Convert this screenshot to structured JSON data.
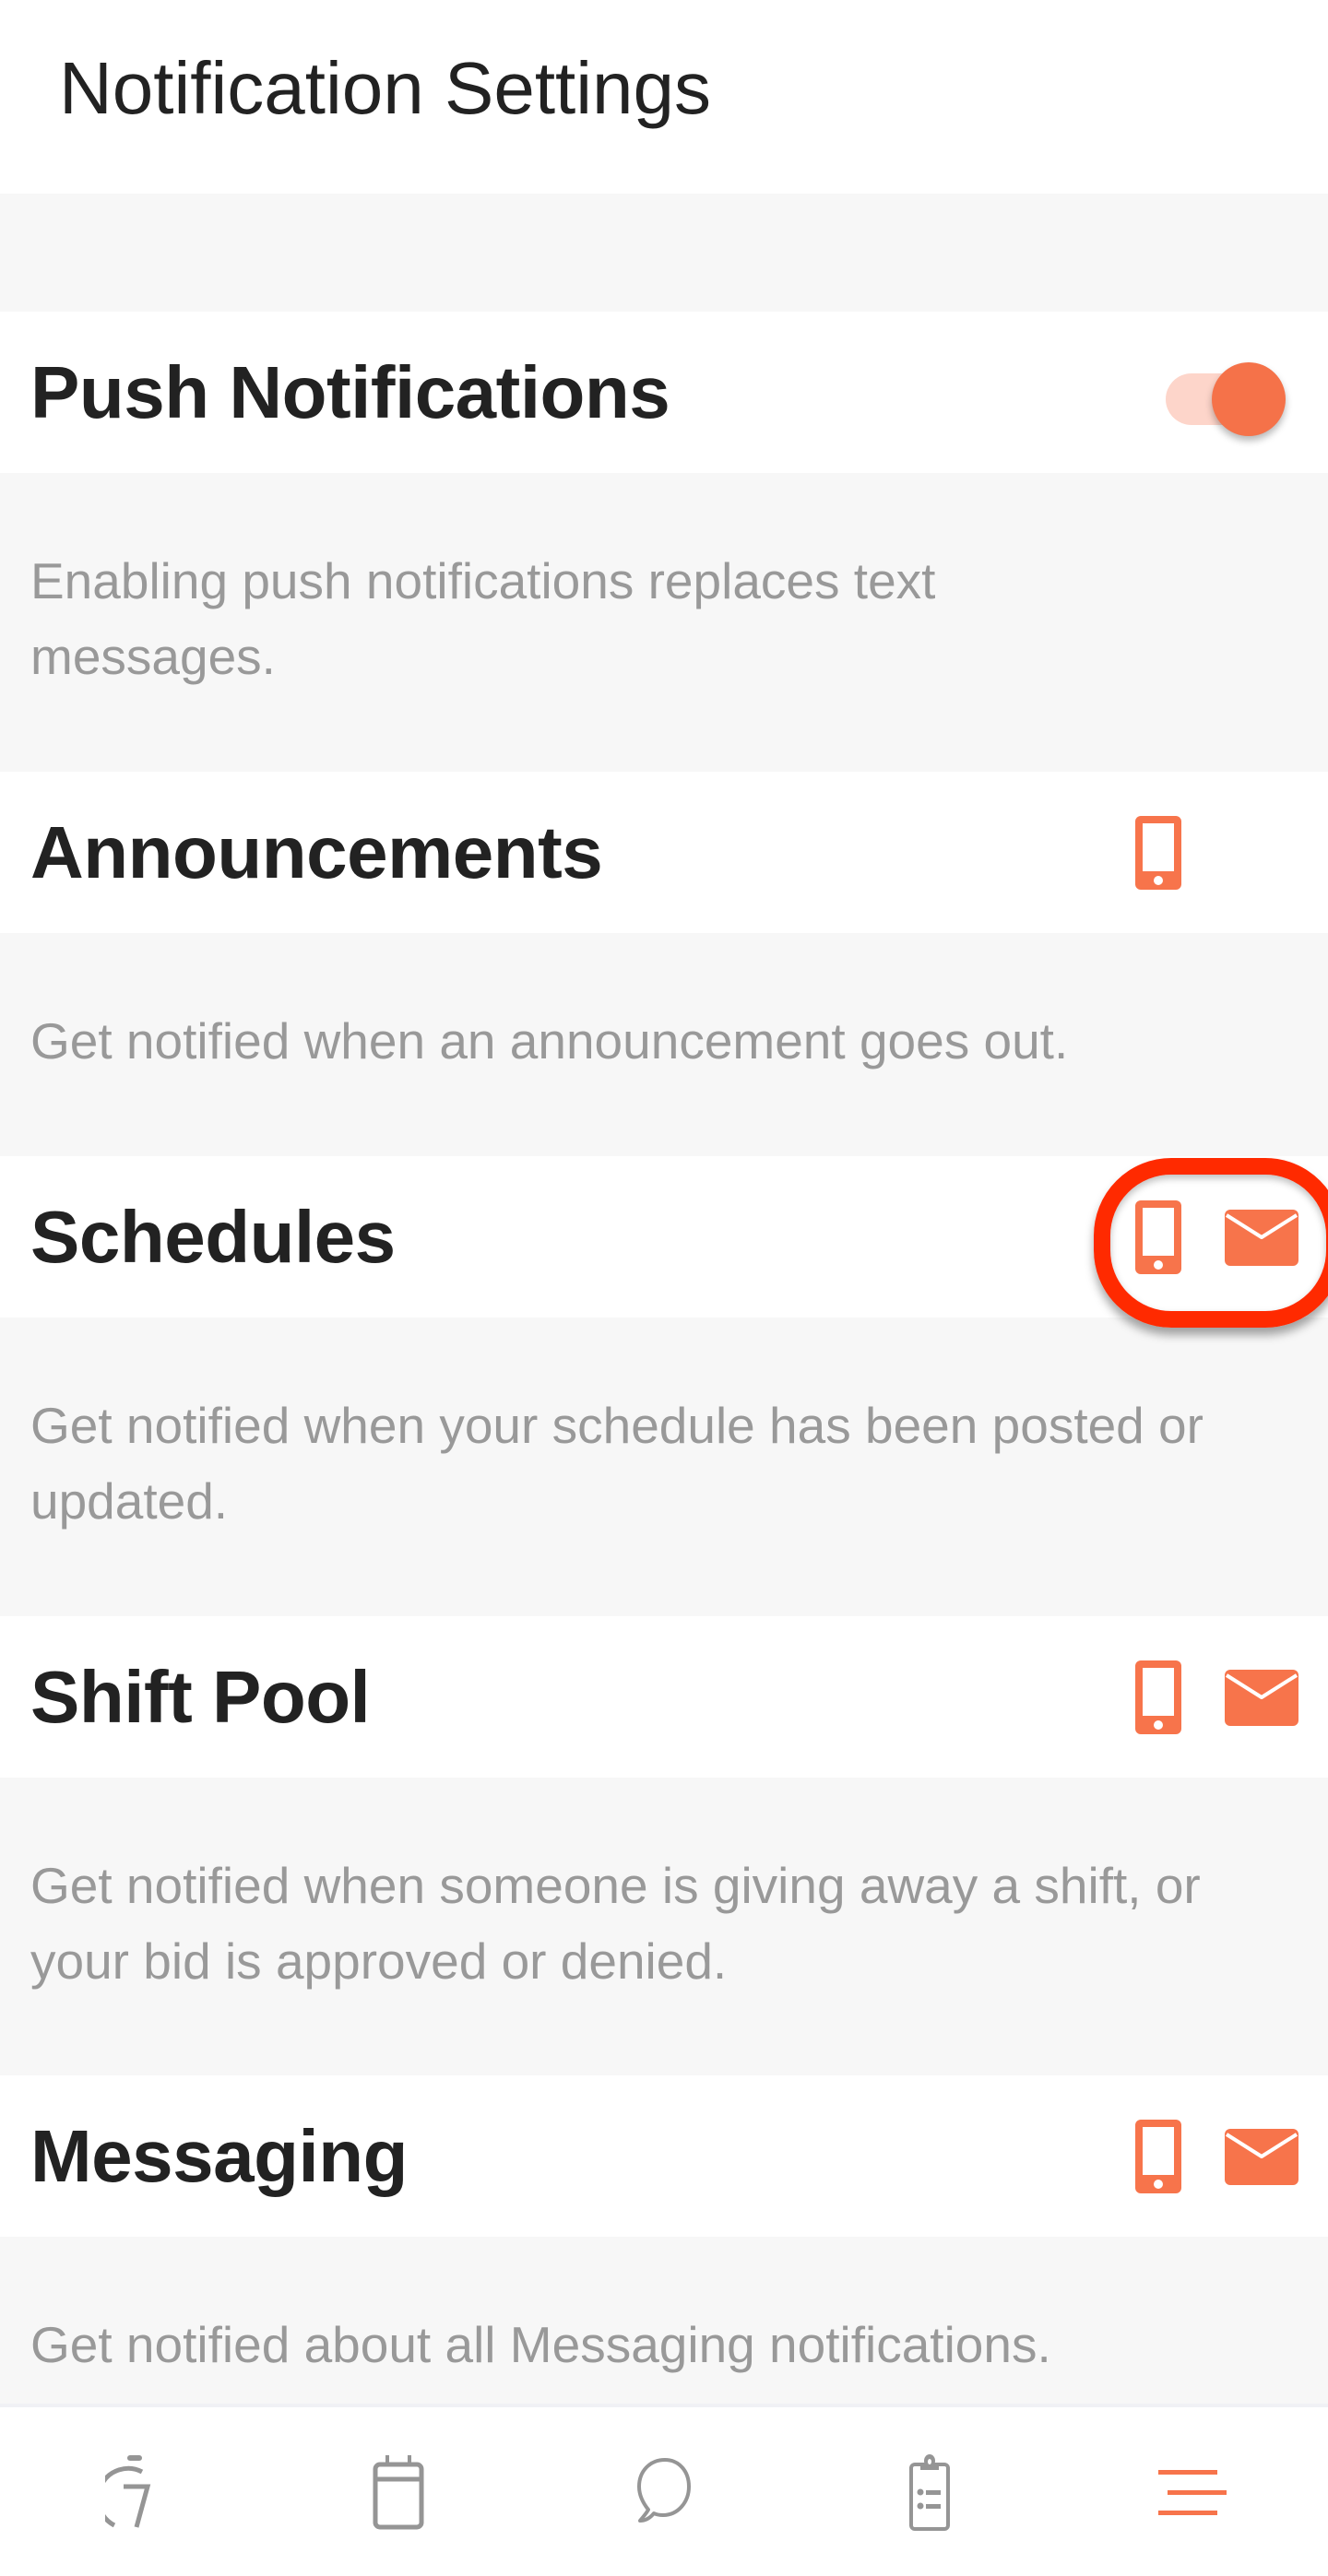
{
  "header": {
    "title": "Notification Settings"
  },
  "colors": {
    "accent": "#F7744B",
    "toggle_track": "#FDD5CA",
    "highlight": "#FF2A00",
    "inactive_icon": "#959595",
    "description_text": "#999999",
    "section_background": "#F7F7F7"
  },
  "push_notifications": {
    "title": "Push Notifications",
    "enabled": true,
    "description": "Enabling push notifications replaces text messages."
  },
  "sections": [
    {
      "title": "Announcements",
      "description": "Get notified when an announcement goes out.",
      "channels": [
        "phone-icon"
      ]
    },
    {
      "title": "Schedules",
      "description": "Get notified when your schedule has been posted or updated.",
      "channels": [
        "phone-icon",
        "mail-icon"
      ],
      "highlighted": true
    },
    {
      "title": "Shift Pool",
      "description": "Get notified when someone is giving away a shift, or your bid is approved or denied.",
      "channels": [
        "phone-icon",
        "mail-icon"
      ]
    },
    {
      "title": "Messaging",
      "description": "Get notified about all Messaging notifications.",
      "channels": [
        "phone-icon",
        "mail-icon"
      ]
    }
  ],
  "tabbar": {
    "items": [
      {
        "icon": "timeclock-icon",
        "active": false
      },
      {
        "icon": "calendar-icon",
        "active": false
      },
      {
        "icon": "chat-bubble-icon",
        "active": false
      },
      {
        "icon": "clipboard-icon",
        "active": false
      },
      {
        "icon": "menu-icon",
        "active": true
      }
    ]
  }
}
